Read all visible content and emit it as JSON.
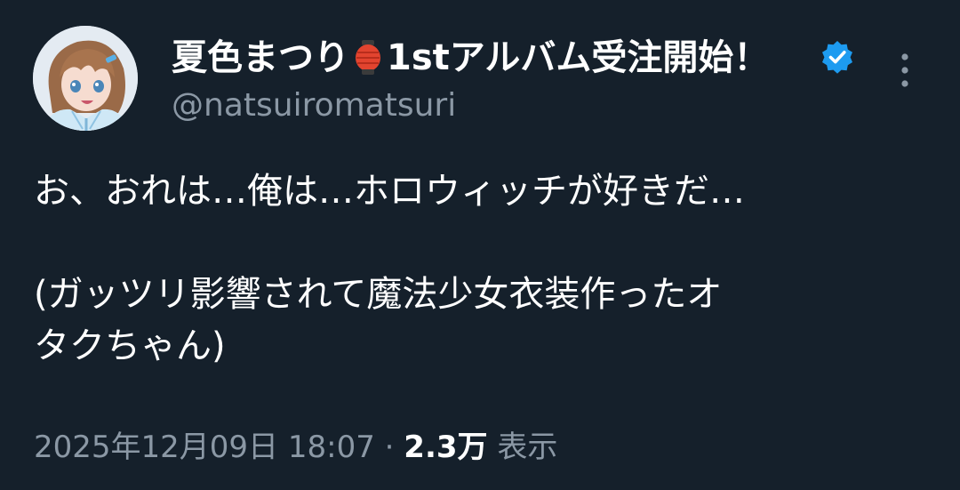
{
  "author": {
    "display_name_prefix": "夏色まつり",
    "display_name_suffix": "1stアルバム受注開始！",
    "lantern_icon": "red-paper-lantern-emoji",
    "verified_icon": "verified-badge-icon",
    "handle": "@natsuiromatsuri",
    "avatar": "anime-girl-avatar"
  },
  "menu": {
    "more_icon": "vertical-ellipsis-icon"
  },
  "tweet": {
    "line1": "お、おれは…俺は…ホロウィッチが好きだ…",
    "line2": "(ガッツリ影響されて魔法少女衣装作ったオ",
    "line3": "タクちゃん)"
  },
  "meta": {
    "timestamp": "2025年12月09日 18:07",
    "separator": " · ",
    "views_count": "2.3万",
    "views_label": "表示"
  },
  "colors": {
    "background": "#15202b",
    "secondary_text": "#8b98a5",
    "verified_blue": "#1d9bf0"
  }
}
